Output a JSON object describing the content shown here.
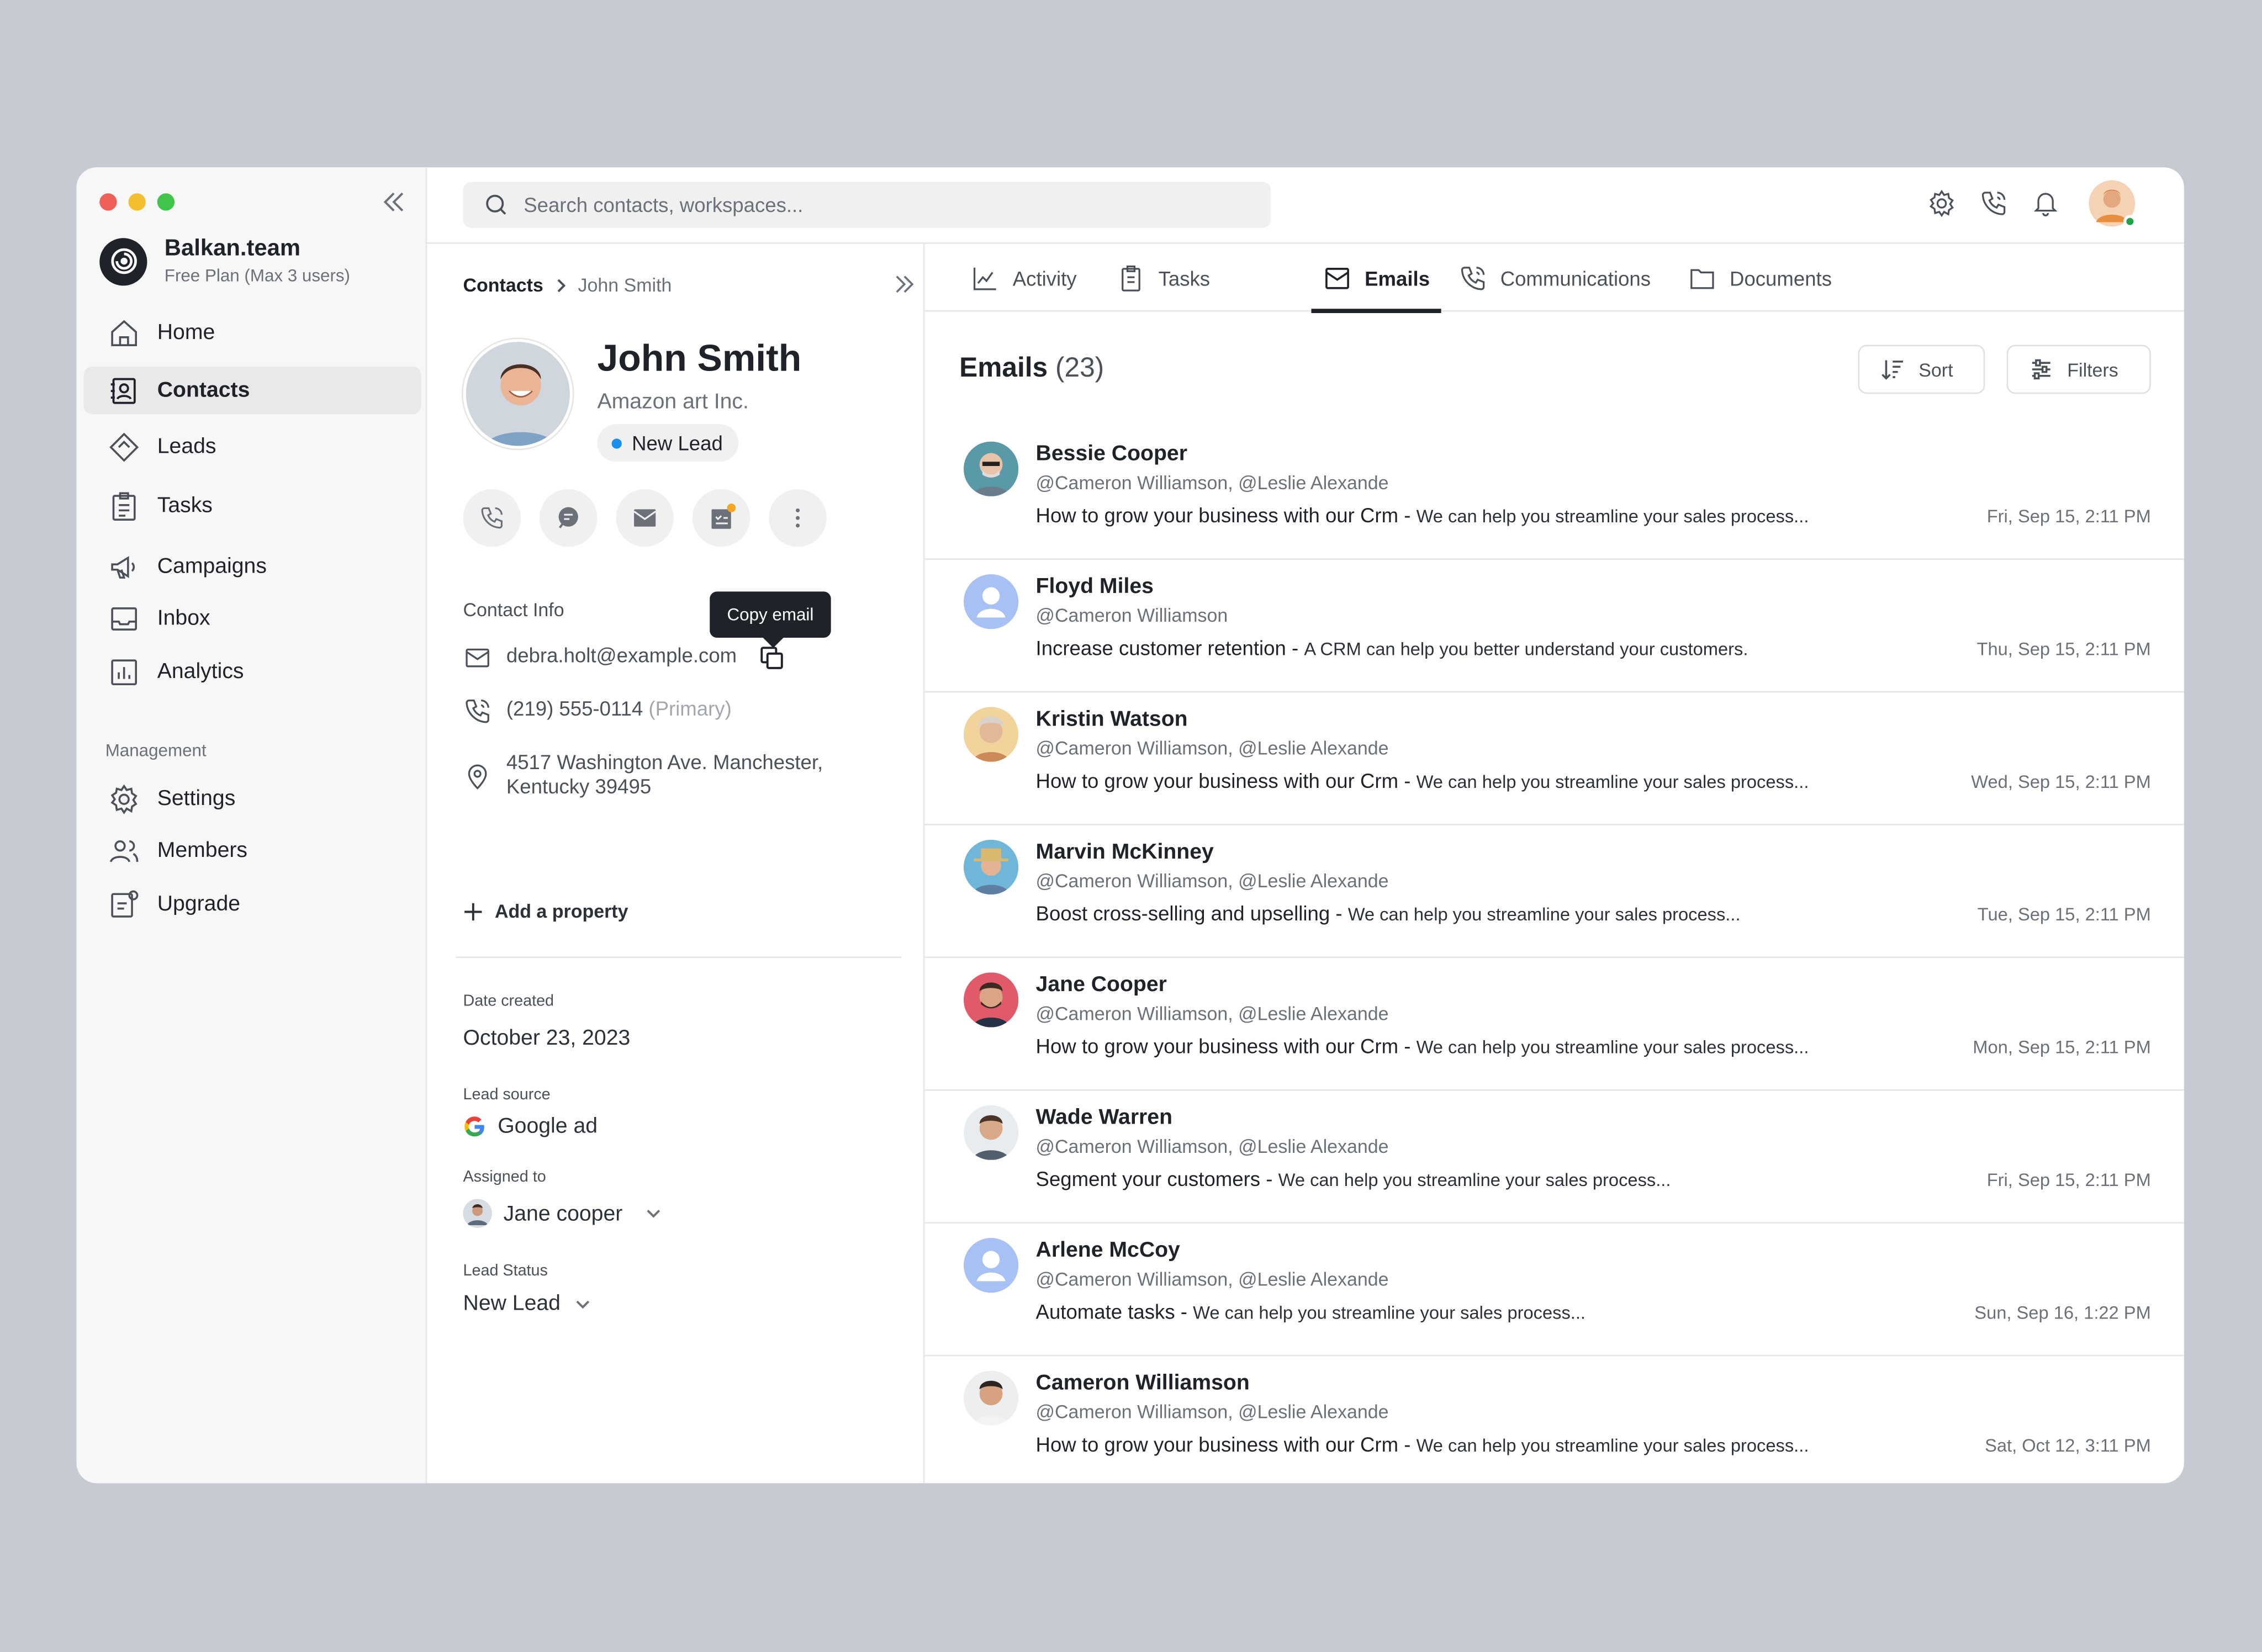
{
  "app": {
    "brand_name": "Balkan.team",
    "brand_plan": "Free Plan (Max 3 users)"
  },
  "sidebar": {
    "items": [
      {
        "label": "Home",
        "icon": "home-icon"
      },
      {
        "label": "Contacts",
        "icon": "contacts-icon",
        "active": true
      },
      {
        "label": "Leads",
        "icon": "leads-icon"
      },
      {
        "label": "Tasks",
        "icon": "tasks-icon"
      },
      {
        "label": "Campaigns",
        "icon": "megaphone-icon"
      },
      {
        "label": "Inbox",
        "icon": "inbox-icon"
      },
      {
        "label": "Analytics",
        "icon": "analytics-icon"
      }
    ],
    "section_title": "Management",
    "management_items": [
      {
        "label": "Settings",
        "icon": "gear-icon"
      },
      {
        "label": "Members",
        "icon": "members-icon"
      },
      {
        "label": "Upgrade",
        "icon": "upgrade-icon"
      }
    ]
  },
  "search": {
    "placeholder": "Search contacts, workspaces..."
  },
  "contact": {
    "breadcrumb_root": "Contacts",
    "breadcrumb_current": "John Smith",
    "name": "John Smith",
    "company": "Amazon art Inc.",
    "status_badge": "New Lead",
    "contact_info_label": "Contact Info",
    "tooltip": "Copy email",
    "email": "debra.holt@example.com",
    "phone": "(219) 555-0114",
    "phone_tag": "(Primary)",
    "address_line1": "4517 Washington Ave. Manchester,",
    "address_line2": "Kentucky 39495",
    "add_property": "Add a property",
    "date_created_label": "Date created",
    "date_created": "October 23, 2023",
    "lead_source_label": "Lead source",
    "lead_source": "Google ad",
    "assigned_to_label": "Assigned to",
    "assigned_to": "Jane cooper",
    "lead_status_label": "Lead Status",
    "lead_status": "New Lead"
  },
  "tabs": [
    {
      "label": "Activity",
      "icon": "activity-icon"
    },
    {
      "label": "Tasks",
      "icon": "tasks-icon"
    },
    {
      "label": "Emails",
      "icon": "email-icon",
      "active": true
    },
    {
      "label": "Communications",
      "icon": "phone-icon"
    },
    {
      "label": "Documents",
      "icon": "folder-icon"
    }
  ],
  "emails": {
    "title": "Emails",
    "count": "(23)",
    "sort_label": "Sort",
    "filters_label": "Filters",
    "items": [
      {
        "sender": "Bessie Cooper",
        "to": "@Cameron Williamson, @Leslie Alexande",
        "subject": "How to grow your business with our Crm",
        "preview": "We can help you streamline your sales process...",
        "date": "Fri, Sep 15, 2:11 PM"
      },
      {
        "sender": "Floyd Miles",
        "to": "@Cameron Williamson",
        "subject": "Increase customer retention",
        "preview": "A CRM can help you better understand your customers.",
        "date": "Thu, Sep 15, 2:11 PM"
      },
      {
        "sender": "Kristin Watson",
        "to": "@Cameron Williamson, @Leslie Alexande",
        "subject": "How to grow your business with our Crm",
        "preview": "We can help you streamline your sales process...",
        "date": "Wed, Sep 15, 2:11 PM"
      },
      {
        "sender": "Marvin McKinney",
        "to": "@Cameron Williamson, @Leslie Alexande",
        "subject": "Boost cross-selling and upselling",
        "preview": "We can help you streamline your sales process...",
        "date": "Tue, Sep 15, 2:11 PM"
      },
      {
        "sender": "Jane Cooper",
        "to": "@Cameron Williamson, @Leslie Alexande",
        "subject": "How to grow your business with our Crm",
        "preview": "We can help you streamline your sales process...",
        "date": "Mon, Sep 15, 2:11 PM"
      },
      {
        "sender": "Wade Warren",
        "to": "@Cameron Williamson, @Leslie Alexande",
        "subject": "Segment your customers",
        "preview": "We can help you streamline your sales process...",
        "date": "Fri, Sep 15, 2:11 PM"
      },
      {
        "sender": "Arlene McCoy",
        "to": "@Cameron Williamson, @Leslie Alexande",
        "subject": "Automate tasks",
        "preview": "We can help you streamline your sales process...",
        "date": "Sun, Sep 16, 1:22 PM"
      },
      {
        "sender": "Cameron Williamson",
        "to": "@Cameron Williamson, @Leslie Alexande",
        "subject": "How to grow your business with our Crm",
        "preview": "We can help you streamline your sales process...",
        "date": "Sat, Oct 12, 3:11 PM"
      }
    ]
  },
  "colors": {
    "background": "#c5cad3",
    "accent_dark": "#1f2329",
    "status_blue": "#1a8ee8",
    "online_green": "#22a34a"
  }
}
